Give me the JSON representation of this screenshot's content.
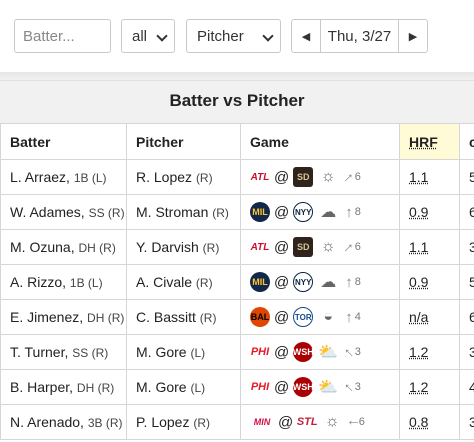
{
  "controls": {
    "batter_placeholder": "Batter...",
    "filter_value": "all",
    "type_value": "Pitcher",
    "date": "Thu, 3/27",
    "prev_icon": "chevron-left-icon",
    "next_icon": "chevron-right-icon"
  },
  "title": "Batter vs Pitcher",
  "columns": {
    "batter": "Batter",
    "pitcher": "Pitcher",
    "game": "Game",
    "hrf": "HRF",
    "extra": "c"
  },
  "rows": [
    {
      "batter": "L. Arraez,",
      "pos": "1B (L)",
      "pitcher": "R. Lopez",
      "phand": "(R)",
      "away": "ATL",
      "home": "SD",
      "weather": "sunny-icon",
      "wind_dir": "up-right",
      "wind": "6",
      "hrf": "1.1",
      "extra": "5"
    },
    {
      "batter": "W. Adames,",
      "pos": "SS (R)",
      "pitcher": "M. Stroman",
      "phand": "(R)",
      "away": "MIL",
      "home": "NYY",
      "weather": "cloud-icon",
      "wind_dir": "up",
      "wind": "8",
      "hrf": "0.9",
      "extra": "6"
    },
    {
      "batter": "M. Ozuna,",
      "pos": "DH (R)",
      "pitcher": "Y. Darvish",
      "phand": "(R)",
      "away": "ATL",
      "home": "SD",
      "weather": "sunny-icon",
      "wind_dir": "up-right",
      "wind": "6",
      "hrf": "1.1",
      "extra": "3"
    },
    {
      "batter": "A. Rizzo,",
      "pos": "1B (L)",
      "pitcher": "A. Civale",
      "phand": "(R)",
      "away": "MIL",
      "home": "NYY",
      "weather": "cloud-icon",
      "wind_dir": "up",
      "wind": "8",
      "hrf": "0.9",
      "extra": "5"
    },
    {
      "batter": "E. Jimenez,",
      "pos": "DH (R)",
      "pitcher": "C. Bassitt",
      "phand": "(R)",
      "away": "BAL",
      "home": "TOR",
      "weather": "dome-icon",
      "wind_dir": "up",
      "wind": "4",
      "hrf": "n/a",
      "extra": "6"
    },
    {
      "batter": "T. Turner,",
      "pos": "SS (R)",
      "pitcher": "M. Gore",
      "phand": "(L)",
      "away": "PHI",
      "home": "WSH",
      "weather": "partly-cloudy-icon",
      "wind_dir": "up-left",
      "wind": "3",
      "hrf": "1.2",
      "extra": "3"
    },
    {
      "batter": "B. Harper,",
      "pos": "DH (R)",
      "pitcher": "M. Gore",
      "phand": "(L)",
      "away": "PHI",
      "home": "WSH",
      "weather": "partly-cloudy-icon",
      "wind_dir": "up-left",
      "wind": "3",
      "hrf": "1.2",
      "extra": "4"
    },
    {
      "batter": "N. Arenado,",
      "pos": "3B (R)",
      "pitcher": "P. Lopez",
      "phand": "(R)",
      "away": "MIN",
      "home": "STL",
      "weather": "partly-sunny-icon",
      "wind_dir": "left",
      "wind": "6",
      "hrf": "0.8",
      "extra": "3"
    }
  ]
}
